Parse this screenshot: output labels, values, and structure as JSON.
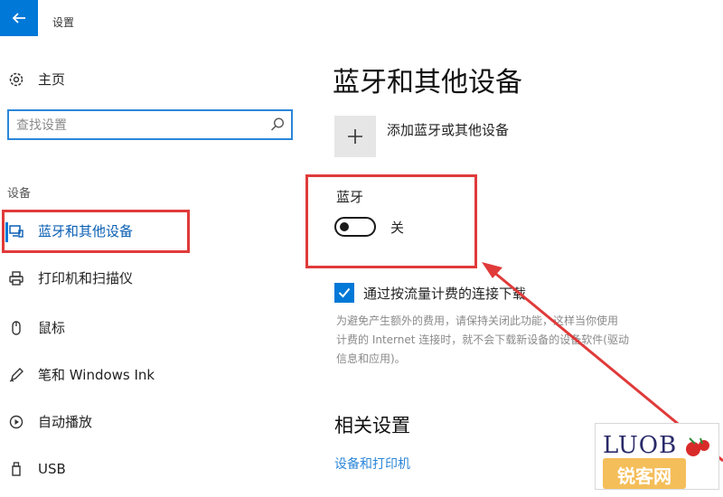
{
  "window": {
    "title": "设置"
  },
  "sidebar": {
    "home_label": "主页",
    "search_placeholder": "查找设置",
    "group_header": "设备",
    "items": [
      {
        "label": "蓝牙和其他设备",
        "icon": "bluetooth-devices-icon",
        "active": true
      },
      {
        "label": "打印机和扫描仪",
        "icon": "printer-icon"
      },
      {
        "label": "鼠标",
        "icon": "mouse-icon"
      },
      {
        "label": "笔和 Windows Ink",
        "icon": "pen-icon"
      },
      {
        "label": "自动播放",
        "icon": "autoplay-icon"
      },
      {
        "label": "USB",
        "icon": "usb-icon"
      }
    ]
  },
  "main": {
    "title": "蓝牙和其他设备",
    "add_device_label": "添加蓝牙或其他设备",
    "bluetooth": {
      "label": "蓝牙",
      "state": "关",
      "on": false
    },
    "metered": {
      "checked": true,
      "label": "通过按流量计费的连接下载",
      "description": [
        "为避免产生额外的费用，请保持关闭此功能，这样当你使用",
        "计费的 Internet 连接时，就不会下载新设备的设备软件(驱动",
        "信息和应用)。"
      ]
    },
    "related": {
      "title": "相关设置",
      "link": "设备和打印机"
    }
  },
  "annotation": {
    "highlight_color": "#e03a3a"
  },
  "watermark": {
    "logo": "LUOB",
    "site": "锐客网"
  },
  "colors": {
    "accent": "#0078d7",
    "link": "#2b86d9",
    "active_text": "#0a5fb4"
  }
}
